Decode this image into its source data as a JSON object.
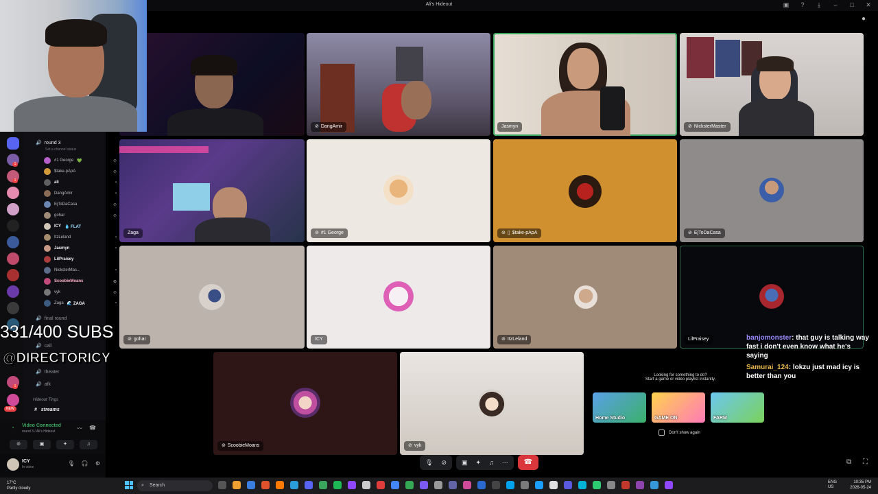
{
  "window": {
    "title": "Ali's Hideout"
  },
  "sidebar": {
    "voice_channel": "round 3",
    "channel_status": "Set a channel status",
    "members": [
      {
        "name": "#1 George",
        "extra": "💚",
        "color": "#b65ec9"
      },
      {
        "name": "$take-pApA",
        "extra": "",
        "color": "#d49a3a"
      },
      {
        "name": "ali",
        "extra": "",
        "color": "#5f5f5f"
      },
      {
        "name": "DangAmir",
        "extra": "",
        "color": "#8a6b55"
      },
      {
        "name": "EjToDaCasa",
        "extra": "",
        "color": "#6b86b3"
      },
      {
        "name": "gohar",
        "extra": "",
        "color": "#9f8a77"
      },
      {
        "name": "ICY",
        "extra": "💧 FLAT",
        "color": "#cfc6b8"
      },
      {
        "name": "ItzLeland",
        "extra": "",
        "color": "#a58c6f"
      },
      {
        "name": "Jasmyn",
        "extra": "",
        "color": "#c99b86"
      },
      {
        "name": "LilPraisey",
        "extra": "",
        "color": "#a83c3c"
      },
      {
        "name": "NicksterMas...",
        "extra": "",
        "color": "#5d6b8a"
      },
      {
        "name": "ScoobieMoans",
        "extra": "",
        "color": "#c24a7a"
      },
      {
        "name": "vyk",
        "extra": "",
        "color": "#777"
      },
      {
        "name": "Zaga",
        "extra": "🌊 ZAGA",
        "color": "#3d5a80"
      }
    ],
    "other_channels": [
      "final round",
      "call",
      "theater",
      "afk"
    ],
    "category": "Hideout Tings",
    "text_channel": "streams",
    "new_badge": "NEW"
  },
  "voice_panel": {
    "status": "Video Connected",
    "location": "round 3 / Ali's Hideout"
  },
  "user_panel": {
    "name": "ICY",
    "status": "In voice"
  },
  "overlay": {
    "subs": "331/400 SUBS",
    "handle": "@DIRECTORICY"
  },
  "tiles": [
    {
      "name": "DangAmir",
      "icon": "mic-off"
    },
    {
      "name": "Jasmyn",
      "icon": ""
    },
    {
      "name": "NicksterMaster",
      "icon": "mic-off"
    },
    {
      "name": "Zaga",
      "icon": ""
    },
    {
      "name": "#1 George",
      "icon": "mic-off"
    },
    {
      "name": "$take-pApA",
      "icon": "mic-off"
    },
    {
      "name": "EjToDaCasa",
      "icon": "mic-off"
    },
    {
      "name": "gohar",
      "icon": "mic-off"
    },
    {
      "name": "ICY",
      "icon": ""
    },
    {
      "name": "ItzLeland",
      "icon": "mic-off"
    },
    {
      "name": "LilPraisey",
      "icon": ""
    },
    {
      "name": "ScoobieMoans",
      "icon": "mic-off"
    },
    {
      "name": "vyk",
      "icon": "mic-off"
    }
  ],
  "chat": [
    {
      "user": "banjomonster",
      "text": ": that guy is talking way fast i don't even know what he's saying"
    },
    {
      "user": "Samurai_124",
      "text": ": lokzu just mad icy is better than you"
    }
  ],
  "suggest": {
    "question": "Looking for something to do?",
    "sub": "Start a game or video playlist instantly.",
    "cards": [
      "Home Studio",
      "GAME ON",
      "FARM"
    ],
    "dont_show": "Don't show again"
  },
  "taskbar": {
    "temp": "17°C",
    "weather": "Partly cloudy",
    "search": "Search",
    "lang1": "ENG",
    "lang2": "US",
    "time": "10:35 PM",
    "date": "2026-05-24"
  }
}
